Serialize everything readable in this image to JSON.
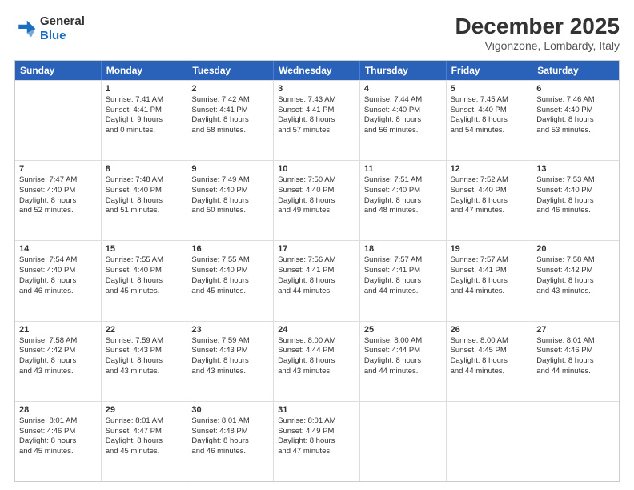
{
  "header": {
    "logo_general": "General",
    "logo_blue": "Blue",
    "month": "December 2025",
    "location": "Vigonzone, Lombardy, Italy"
  },
  "weekdays": [
    "Sunday",
    "Monday",
    "Tuesday",
    "Wednesday",
    "Thursday",
    "Friday",
    "Saturday"
  ],
  "rows": [
    [
      {
        "day": "",
        "lines": []
      },
      {
        "day": "1",
        "lines": [
          "Sunrise: 7:41 AM",
          "Sunset: 4:41 PM",
          "Daylight: 9 hours",
          "and 0 minutes."
        ]
      },
      {
        "day": "2",
        "lines": [
          "Sunrise: 7:42 AM",
          "Sunset: 4:41 PM",
          "Daylight: 8 hours",
          "and 58 minutes."
        ]
      },
      {
        "day": "3",
        "lines": [
          "Sunrise: 7:43 AM",
          "Sunset: 4:41 PM",
          "Daylight: 8 hours",
          "and 57 minutes."
        ]
      },
      {
        "day": "4",
        "lines": [
          "Sunrise: 7:44 AM",
          "Sunset: 4:40 PM",
          "Daylight: 8 hours",
          "and 56 minutes."
        ]
      },
      {
        "day": "5",
        "lines": [
          "Sunrise: 7:45 AM",
          "Sunset: 4:40 PM",
          "Daylight: 8 hours",
          "and 54 minutes."
        ]
      },
      {
        "day": "6",
        "lines": [
          "Sunrise: 7:46 AM",
          "Sunset: 4:40 PM",
          "Daylight: 8 hours",
          "and 53 minutes."
        ]
      }
    ],
    [
      {
        "day": "7",
        "lines": [
          "Sunrise: 7:47 AM",
          "Sunset: 4:40 PM",
          "Daylight: 8 hours",
          "and 52 minutes."
        ]
      },
      {
        "day": "8",
        "lines": [
          "Sunrise: 7:48 AM",
          "Sunset: 4:40 PM",
          "Daylight: 8 hours",
          "and 51 minutes."
        ]
      },
      {
        "day": "9",
        "lines": [
          "Sunrise: 7:49 AM",
          "Sunset: 4:40 PM",
          "Daylight: 8 hours",
          "and 50 minutes."
        ]
      },
      {
        "day": "10",
        "lines": [
          "Sunrise: 7:50 AM",
          "Sunset: 4:40 PM",
          "Daylight: 8 hours",
          "and 49 minutes."
        ]
      },
      {
        "day": "11",
        "lines": [
          "Sunrise: 7:51 AM",
          "Sunset: 4:40 PM",
          "Daylight: 8 hours",
          "and 48 minutes."
        ]
      },
      {
        "day": "12",
        "lines": [
          "Sunrise: 7:52 AM",
          "Sunset: 4:40 PM",
          "Daylight: 8 hours",
          "and 47 minutes."
        ]
      },
      {
        "day": "13",
        "lines": [
          "Sunrise: 7:53 AM",
          "Sunset: 4:40 PM",
          "Daylight: 8 hours",
          "and 46 minutes."
        ]
      }
    ],
    [
      {
        "day": "14",
        "lines": [
          "Sunrise: 7:54 AM",
          "Sunset: 4:40 PM",
          "Daylight: 8 hours",
          "and 46 minutes."
        ]
      },
      {
        "day": "15",
        "lines": [
          "Sunrise: 7:55 AM",
          "Sunset: 4:40 PM",
          "Daylight: 8 hours",
          "and 45 minutes."
        ]
      },
      {
        "day": "16",
        "lines": [
          "Sunrise: 7:55 AM",
          "Sunset: 4:40 PM",
          "Daylight: 8 hours",
          "and 45 minutes."
        ]
      },
      {
        "day": "17",
        "lines": [
          "Sunrise: 7:56 AM",
          "Sunset: 4:41 PM",
          "Daylight: 8 hours",
          "and 44 minutes."
        ]
      },
      {
        "day": "18",
        "lines": [
          "Sunrise: 7:57 AM",
          "Sunset: 4:41 PM",
          "Daylight: 8 hours",
          "and 44 minutes."
        ]
      },
      {
        "day": "19",
        "lines": [
          "Sunrise: 7:57 AM",
          "Sunset: 4:41 PM",
          "Daylight: 8 hours",
          "and 44 minutes."
        ]
      },
      {
        "day": "20",
        "lines": [
          "Sunrise: 7:58 AM",
          "Sunset: 4:42 PM",
          "Daylight: 8 hours",
          "and 43 minutes."
        ]
      }
    ],
    [
      {
        "day": "21",
        "lines": [
          "Sunrise: 7:58 AM",
          "Sunset: 4:42 PM",
          "Daylight: 8 hours",
          "and 43 minutes."
        ]
      },
      {
        "day": "22",
        "lines": [
          "Sunrise: 7:59 AM",
          "Sunset: 4:43 PM",
          "Daylight: 8 hours",
          "and 43 minutes."
        ]
      },
      {
        "day": "23",
        "lines": [
          "Sunrise: 7:59 AM",
          "Sunset: 4:43 PM",
          "Daylight: 8 hours",
          "and 43 minutes."
        ]
      },
      {
        "day": "24",
        "lines": [
          "Sunrise: 8:00 AM",
          "Sunset: 4:44 PM",
          "Daylight: 8 hours",
          "and 43 minutes."
        ]
      },
      {
        "day": "25",
        "lines": [
          "Sunrise: 8:00 AM",
          "Sunset: 4:44 PM",
          "Daylight: 8 hours",
          "and 44 minutes."
        ]
      },
      {
        "day": "26",
        "lines": [
          "Sunrise: 8:00 AM",
          "Sunset: 4:45 PM",
          "Daylight: 8 hours",
          "and 44 minutes."
        ]
      },
      {
        "day": "27",
        "lines": [
          "Sunrise: 8:01 AM",
          "Sunset: 4:46 PM",
          "Daylight: 8 hours",
          "and 44 minutes."
        ]
      }
    ],
    [
      {
        "day": "28",
        "lines": [
          "Sunrise: 8:01 AM",
          "Sunset: 4:46 PM",
          "Daylight: 8 hours",
          "and 45 minutes."
        ]
      },
      {
        "day": "29",
        "lines": [
          "Sunrise: 8:01 AM",
          "Sunset: 4:47 PM",
          "Daylight: 8 hours",
          "and 45 minutes."
        ]
      },
      {
        "day": "30",
        "lines": [
          "Sunrise: 8:01 AM",
          "Sunset: 4:48 PM",
          "Daylight: 8 hours",
          "and 46 minutes."
        ]
      },
      {
        "day": "31",
        "lines": [
          "Sunrise: 8:01 AM",
          "Sunset: 4:49 PM",
          "Daylight: 8 hours",
          "and 47 minutes."
        ]
      },
      {
        "day": "",
        "lines": []
      },
      {
        "day": "",
        "lines": []
      },
      {
        "day": "",
        "lines": []
      }
    ]
  ]
}
